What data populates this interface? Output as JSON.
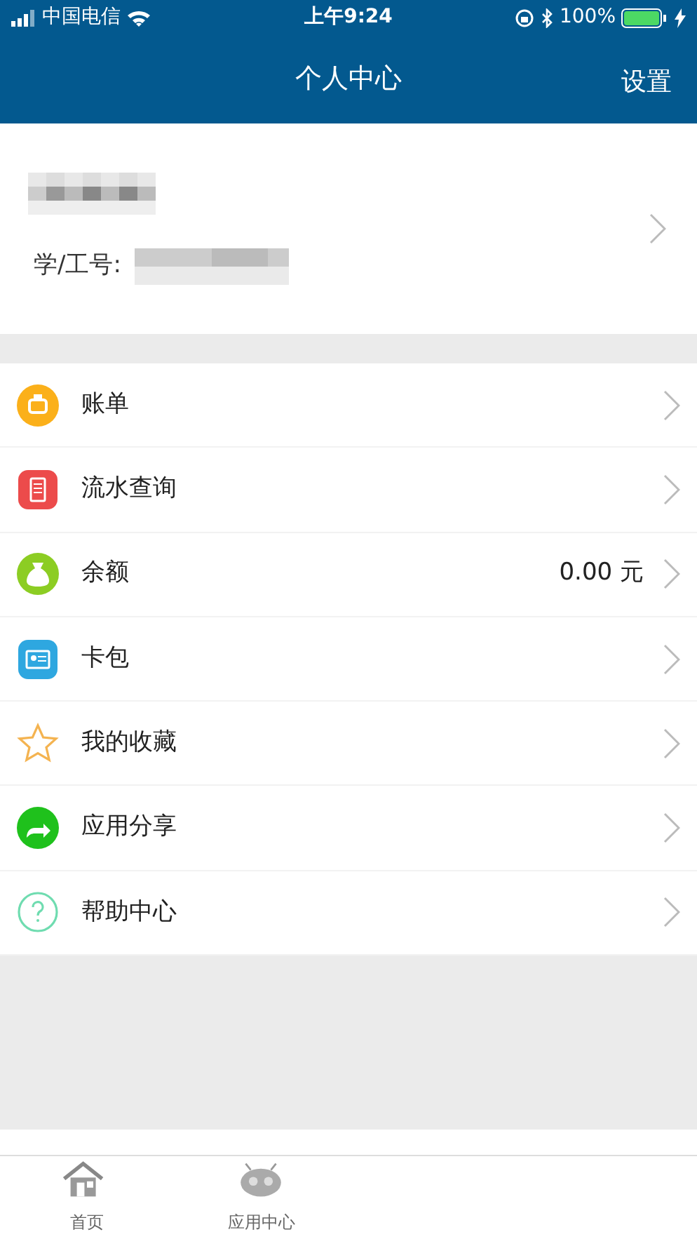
{
  "status_bar": {
    "carrier": "中国电信",
    "time": "上午9:24",
    "battery": "100%"
  },
  "nav": {
    "title": "个人中心",
    "action": "设置"
  },
  "profile": {
    "id_label": "学/工号:"
  },
  "menu": [
    {
      "label": "账单"
    },
    {
      "label": "流水查询"
    },
    {
      "label": "余额",
      "value": "0.00 元"
    },
    {
      "label": "卡包"
    },
    {
      "label": "我的收藏"
    },
    {
      "label": "应用分享"
    },
    {
      "label": "帮助中心"
    }
  ],
  "tab_bar": [
    {
      "label": "首页"
    },
    {
      "label": "应用中心"
    }
  ]
}
